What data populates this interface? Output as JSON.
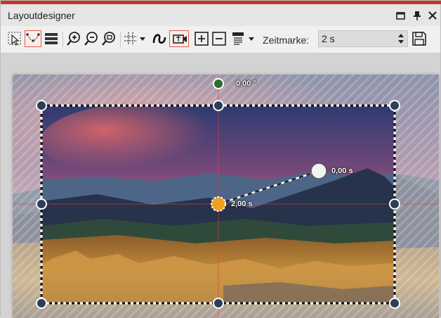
{
  "window": {
    "title": "Layoutdesigner",
    "accent_color": "#c0392b"
  },
  "window_controls": [
    "restore-icon",
    "pin-icon",
    "close-icon"
  ],
  "toolbar": {
    "tools": [
      "select-tool-icon",
      "path-tool-icon",
      "layers-icon",
      "zoom-in-icon",
      "zoom-out-icon",
      "zoom-fit-icon",
      "grid-icon",
      "curve-icon",
      "camera-icon",
      "add-keyframe-icon",
      "remove-keyframe-icon",
      "align-icon",
      "save-icon"
    ],
    "zeitmarke_label": "Zeitmarke:",
    "zeitmarke_value": "2 s"
  },
  "canvas": {
    "rotation_label": "0,00 °",
    "path_start_label": "0,00 s",
    "path_end_label": "2,00 s",
    "handle_color": "#2f3e57",
    "rotation_handle_color": "#2e6b30",
    "keyframe_color": "#f0a020"
  }
}
